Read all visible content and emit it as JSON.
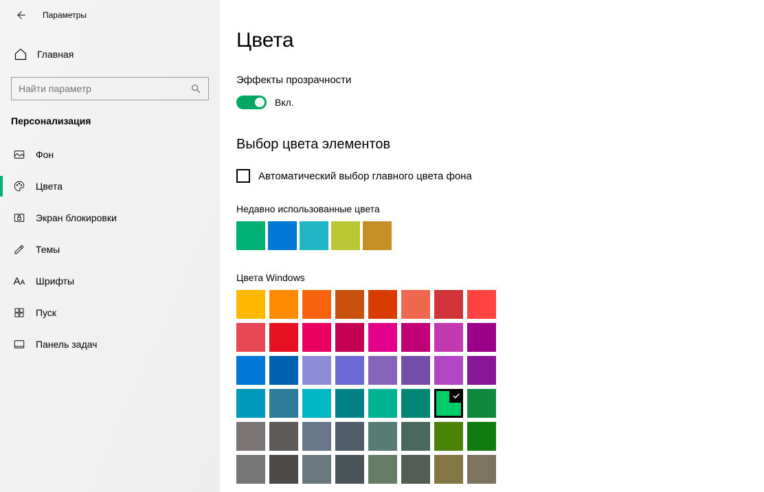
{
  "topbar": {
    "title": "Параметры"
  },
  "home_label": "Главная",
  "search": {
    "placeholder": "Найти параметр"
  },
  "category_title": "Персонализация",
  "nav": [
    {
      "id": "background",
      "label": "Фон"
    },
    {
      "id": "colors",
      "label": "Цвета",
      "active": true
    },
    {
      "id": "lockscreen",
      "label": "Экран блокировки"
    },
    {
      "id": "themes",
      "label": "Темы"
    },
    {
      "id": "fonts",
      "label": "Шрифты"
    },
    {
      "id": "start",
      "label": "Пуск"
    },
    {
      "id": "taskbar",
      "label": "Панель задач"
    }
  ],
  "page_title": "Цвета",
  "transparency": {
    "label": "Эффекты прозрачности",
    "state_text": "Вкл.",
    "on": true
  },
  "accent_section_title": "Выбор цвета элементов",
  "auto_pick_label": "Автоматический выбор главного цвета фона",
  "recent_label": "Недавно использованные цвета",
  "recent_colors": [
    "#00b074",
    "#0078d7",
    "#21b6c6",
    "#b8c733",
    "#c69027"
  ],
  "windows_label": "Цвета Windows",
  "windows_colors": [
    [
      "#ffb900",
      "#ff8c00",
      "#f7630c",
      "#ca5010",
      "#da3b01",
      "#ef6950",
      "#d13438",
      "#ff4343"
    ],
    [
      "#e74856",
      "#e81123",
      "#ea005e",
      "#c30052",
      "#e3008c",
      "#bf0077",
      "#c239b3",
      "#9a0089"
    ],
    [
      "#0078d7",
      "#0063b1",
      "#8e8cd8",
      "#6b69d6",
      "#8764b8",
      "#744da9",
      "#b146c2",
      "#881798"
    ],
    [
      "#0099bc",
      "#2d7d9a",
      "#00b7c3",
      "#038387",
      "#00b294",
      "#018574",
      "#00cc6a",
      "#10893e"
    ],
    [
      "#7a7574",
      "#5d5a58",
      "#68768a",
      "#515c6b",
      "#567c73",
      "#486860",
      "#498205",
      "#107c10"
    ],
    [
      "#767676",
      "#4c4a48",
      "#69797e",
      "#4a5459",
      "#647c64",
      "#525e54",
      "#847545",
      "#7e735f"
    ]
  ],
  "selected_color": [
    3,
    6
  ]
}
